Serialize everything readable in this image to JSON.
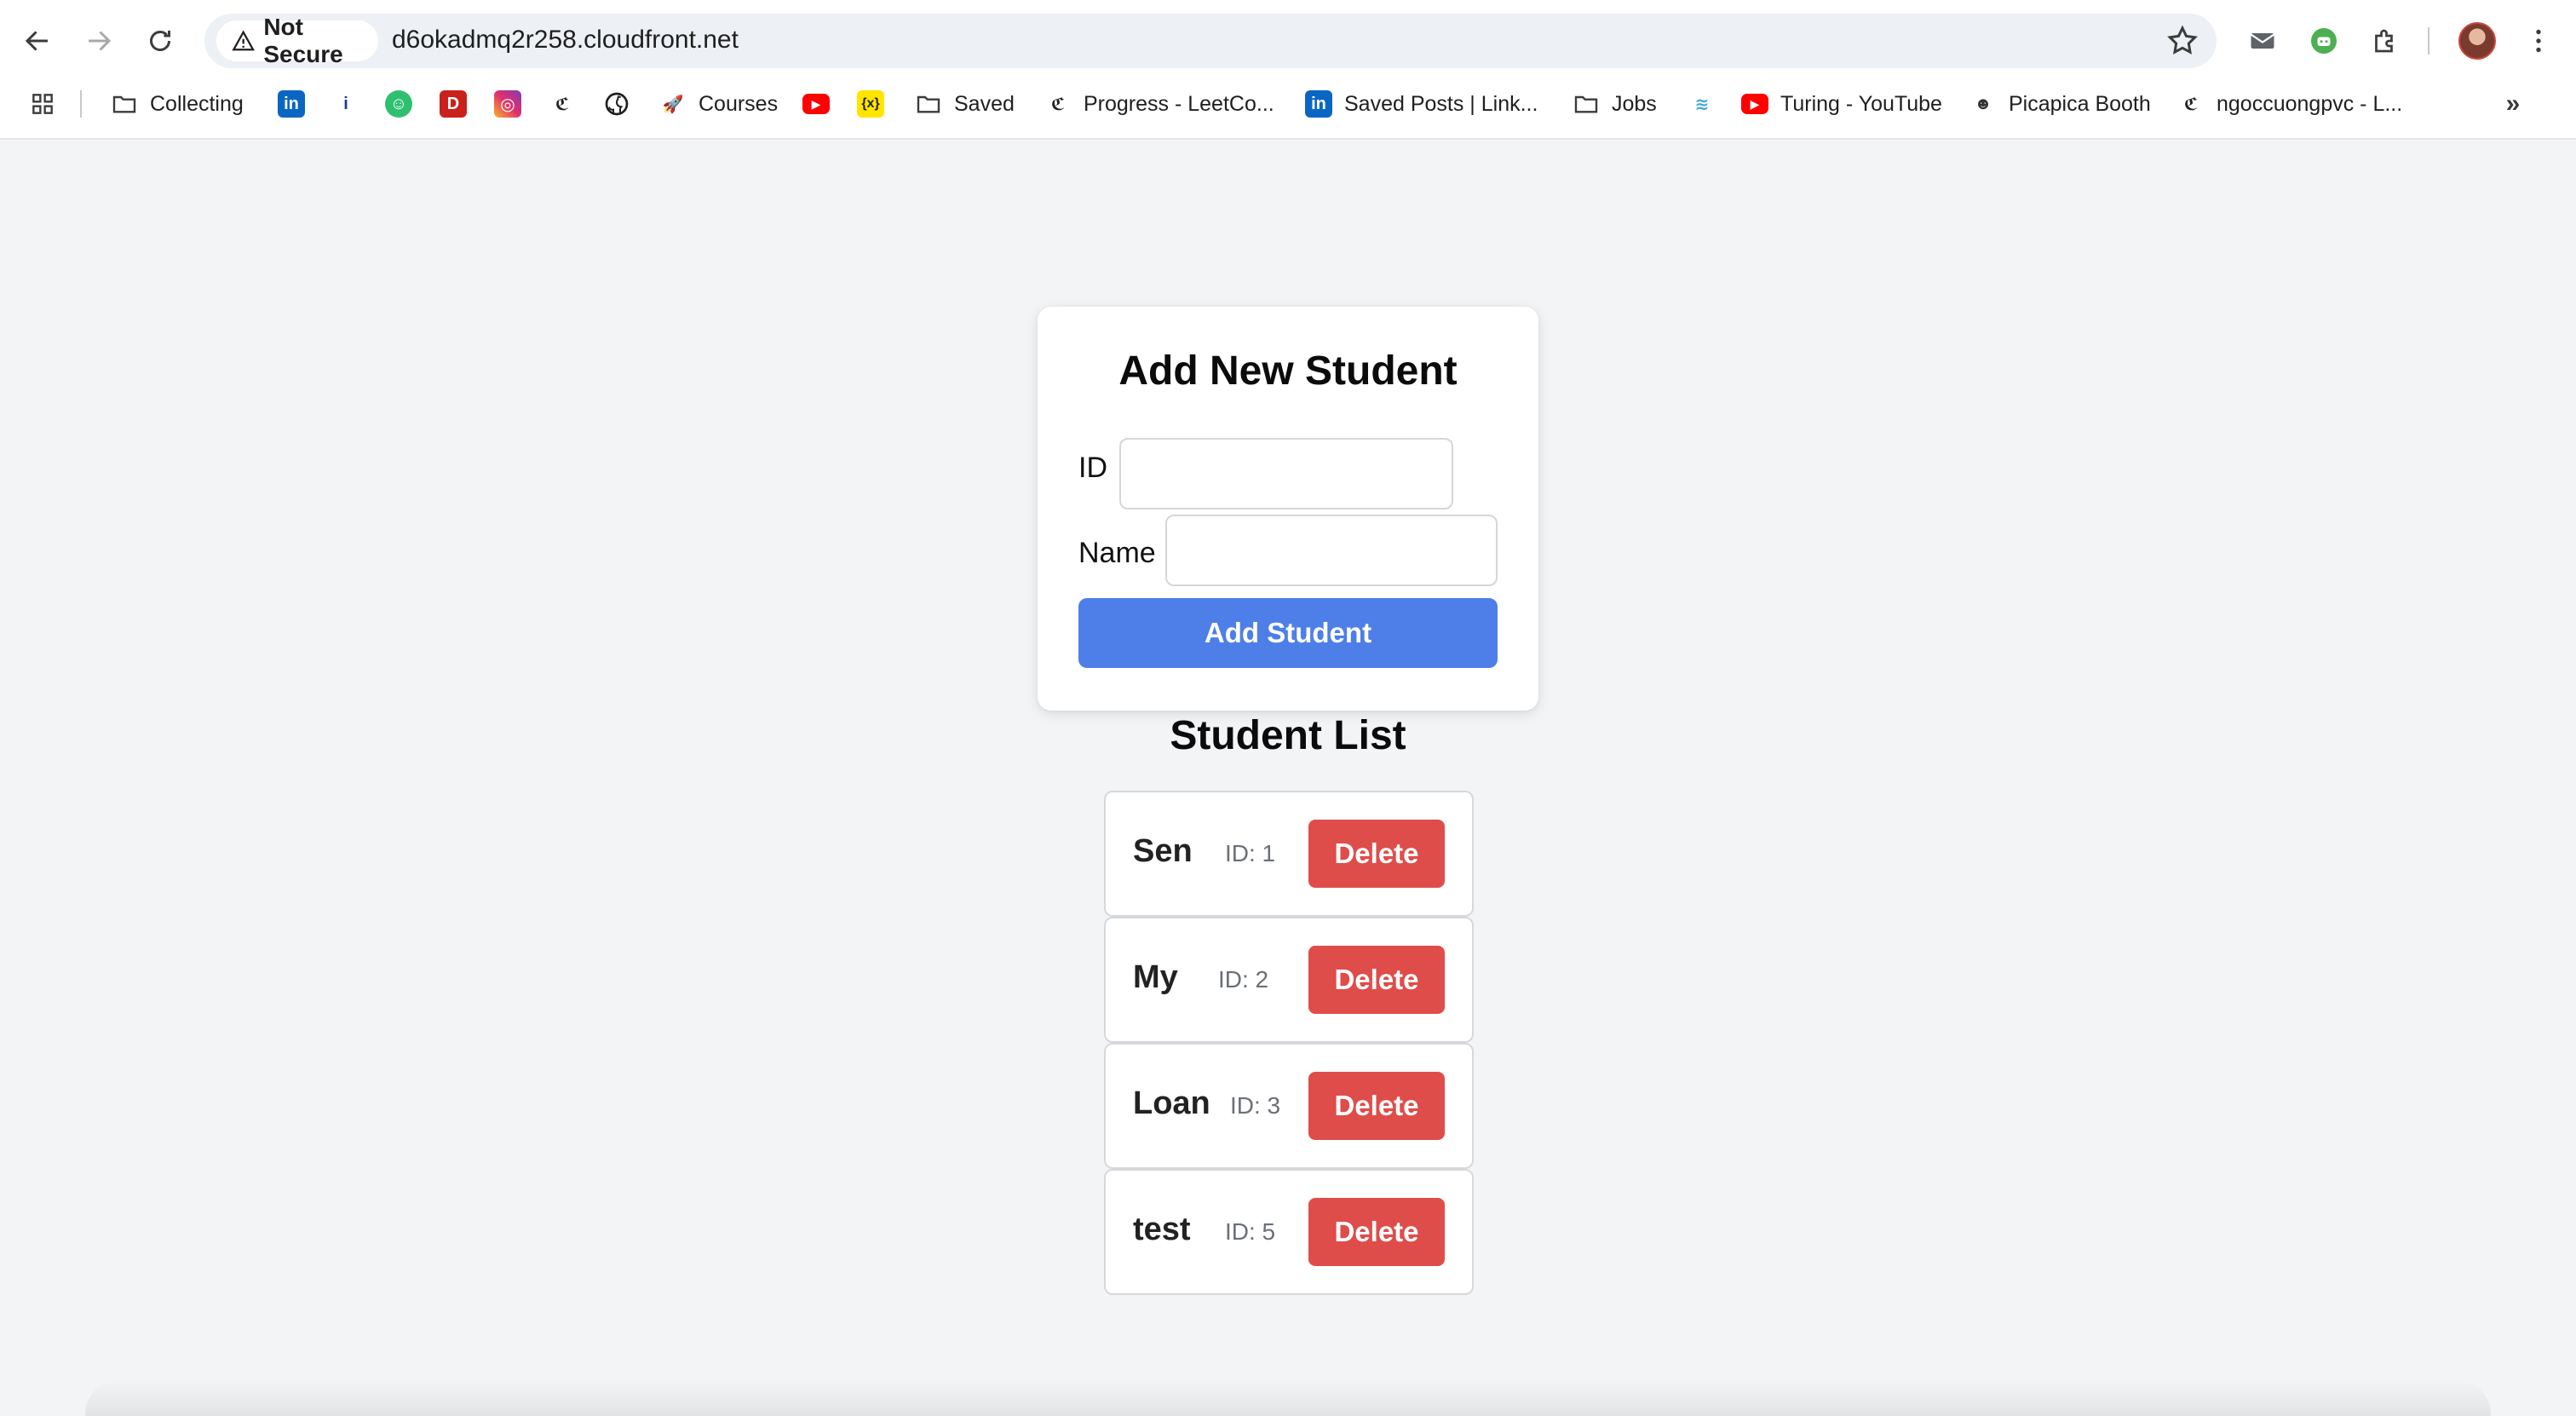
{
  "browser": {
    "security_label": "Not Secure",
    "url": "d6okadmq2r258.cloudfront.net"
  },
  "bookmarks": [
    {
      "label": "Collecting",
      "icon": "folder-icon"
    },
    {
      "label": "",
      "icon": "linkedin-icon"
    },
    {
      "label": "",
      "icon": "info-icon"
    },
    {
      "label": "",
      "icon": "chat-icon"
    },
    {
      "label": "",
      "icon": "dev-icon"
    },
    {
      "label": "",
      "icon": "instagram-icon"
    },
    {
      "label": "",
      "icon": "leetcode-icon"
    },
    {
      "label": "",
      "icon": "github-icon"
    },
    {
      "label": "Courses",
      "icon": "rocket-icon"
    },
    {
      "label": "",
      "icon": "youtube-icon"
    },
    {
      "label": "",
      "icon": "variable-icon"
    },
    {
      "label": "Saved",
      "icon": "folder-icon"
    },
    {
      "label": "Progress - LeetCo...",
      "icon": "leetcode-icon"
    },
    {
      "label": "Saved Posts | Link...",
      "icon": "linkedin-icon"
    },
    {
      "label": "Jobs",
      "icon": "folder-icon"
    },
    {
      "label": "",
      "icon": "stack-icon"
    },
    {
      "label": "Turing - YouTube",
      "icon": "youtube-icon"
    },
    {
      "label": "Picapica Booth",
      "icon": "person-icon"
    },
    {
      "label": "ngoccuongpvc - L...",
      "icon": "leetcode-icon"
    }
  ],
  "form": {
    "title": "Add New Student",
    "id_label": "ID",
    "id_value": "",
    "name_label": "Name",
    "name_value": "",
    "submit_label": "Add Student"
  },
  "student_list": {
    "title": "Student List",
    "delete_label": "Delete",
    "students": [
      {
        "name": "Sen",
        "id_text": "ID: 1"
      },
      {
        "name": "My",
        "id_text": "ID: 2"
      },
      {
        "name": "Loan",
        "id_text": "ID: 3"
      },
      {
        "name": "test",
        "id_text": "ID: 5"
      }
    ]
  },
  "colors": {
    "primary_button": "#4e7fe8",
    "delete_button": "#df4d4a",
    "page_background": "#f3f4f6"
  }
}
